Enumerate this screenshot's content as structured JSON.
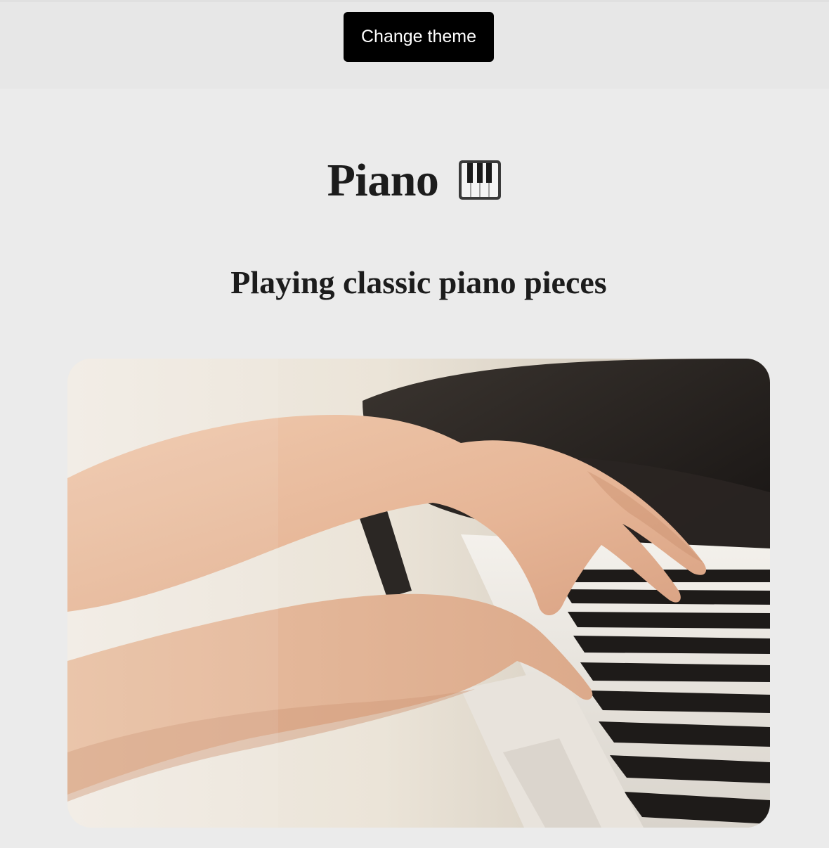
{
  "header": {
    "theme_button_label": "Change theme"
  },
  "main": {
    "title": "Piano",
    "title_icon": "piano-keys-icon",
    "subtitle": "Playing classic piano pieces",
    "hero_image": "hands-playing-piano-photo"
  },
  "colors": {
    "page_background": "#ebebeb",
    "topbar_background": "#e7e7e7",
    "button_background": "#000000",
    "button_text": "#ffffff",
    "text": "#1c1c1c"
  }
}
